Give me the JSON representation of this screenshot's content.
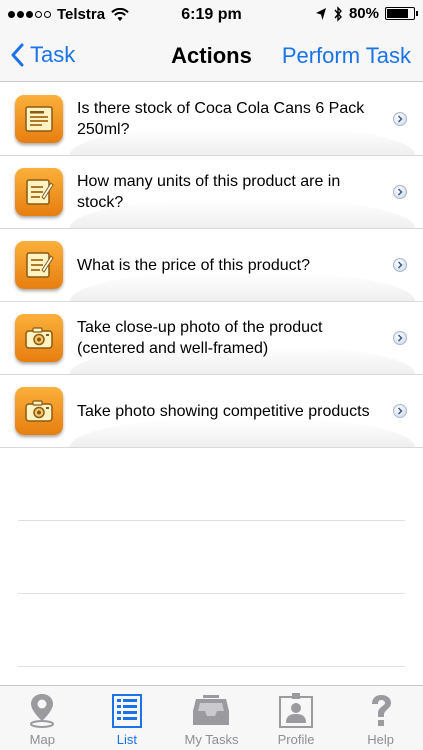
{
  "status_bar": {
    "carrier": "Telstra",
    "time": "6:19 pm",
    "battery_percent_label": "80%",
    "battery_level": 0.8
  },
  "nav": {
    "back_label": "Task",
    "title": "Actions",
    "action_label": "Perform Task"
  },
  "items": [
    {
      "text": "Is there stock of Coca Cola Cans 6 Pack 250ml?",
      "icon": "form-icon"
    },
    {
      "text": "How many units of this product are in stock?",
      "icon": "notepad-icon"
    },
    {
      "text": "What is the price of this product?",
      "icon": "notepad-icon"
    },
    {
      "text": "Take close-up photo of the product (centered and well-framed)",
      "icon": "camera-icon"
    },
    {
      "text": "Take photo showing competitive products",
      "icon": "camera-icon"
    }
  ],
  "tabs": [
    {
      "label": "Map",
      "icon": "map-pin-icon",
      "active": false
    },
    {
      "label": "List",
      "icon": "list-icon",
      "active": true
    },
    {
      "label": "My Tasks",
      "icon": "inbox-tray-icon",
      "active": false
    },
    {
      "label": "Profile",
      "icon": "id-card-icon",
      "active": false
    },
    {
      "label": "Help",
      "icon": "question-mark-icon",
      "active": false
    }
  ],
  "colors": {
    "accent": "#1a73e8",
    "icon_orange": "#f39a24",
    "tab_inactive": "#8e8e93"
  }
}
